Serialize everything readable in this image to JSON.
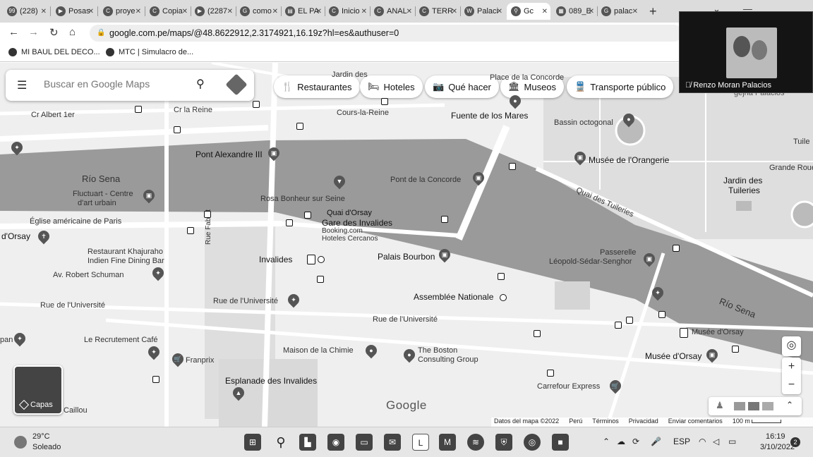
{
  "browser": {
    "tabs": [
      {
        "icon": "notification-badge-icon",
        "title": "(228)"
      },
      {
        "icon": "video-icon",
        "title": "Posas"
      },
      {
        "icon": "c-logo-icon",
        "title": "proye"
      },
      {
        "icon": "c-logo-icon",
        "title": "Copia"
      },
      {
        "icon": "youtube-icon",
        "title": "(2287"
      },
      {
        "icon": "google-icon",
        "title": "como"
      },
      {
        "icon": "newspaper-icon",
        "title": "EL PA"
      },
      {
        "icon": "c-logo-icon",
        "title": "Inicio"
      },
      {
        "icon": "c-logo-icon",
        "title": "ANAL"
      },
      {
        "icon": "c-logo-icon",
        "title": "TERR"
      },
      {
        "icon": "wikipedia-icon",
        "title": "Palaci"
      },
      {
        "icon": "maps-pin-icon",
        "title": "Gc"
      },
      {
        "icon": "grid-icon",
        "title": "089_E"
      },
      {
        "icon": "google-icon",
        "title": "palac"
      }
    ],
    "active_tab_index": 11,
    "url": "google.com.pe/maps/@48.8622912,2.3174921,16.19z?hl=es&authuser=0",
    "bookmarks": [
      "MI BAUL DEL DECO...",
      "MTC | Simulacro de..."
    ],
    "new_tab_label": "+"
  },
  "video_call": {
    "participant": "Renzo Moran Palacios"
  },
  "maps": {
    "search_placeholder": "Buscar en Google Maps",
    "chips": [
      {
        "icon": "fork-knife-icon",
        "label": "Restaurantes"
      },
      {
        "icon": "bed-icon",
        "label": "Hoteles"
      },
      {
        "icon": "camera-icon",
        "label": "Qué hacer"
      },
      {
        "icon": "museum-icon",
        "label": "Museos"
      },
      {
        "icon": "train-icon",
        "label": "Transporte público"
      }
    ],
    "layers_label": "Capas",
    "zoom_in": "+",
    "zoom_out": "−",
    "logo": "Google",
    "attribution": {
      "data": "Datos del mapa ©2022",
      "country": "Perú",
      "terms": "Términos",
      "privacy": "Privacidad",
      "feedback": "Enviar comentarios",
      "scale": "100 m"
    },
    "labels": {
      "jardin_top": "Jardin des",
      "place_top": "Place de la Concorde",
      "cr_albert": "Cr Albert 1er",
      "cr_la_reine": "Cr la Reine",
      "cours_la_reine": "Cours-la-Reine",
      "fuente": "Fuente de los Mares",
      "bassin": "Bassin octogonal",
      "tuile": "Tuile",
      "pont_alexandre": "Pont Alexandre III",
      "musee_orangerie": "Musée de l'Orangerie",
      "grande_roue": "Grande Roue",
      "rio_sena_1": "Río Sena",
      "fluctuart": "Fluctuart - Centre",
      "fluctuart_2": "d'art urbain",
      "rosa_bonheur": "Rosa Bonheur sur Seine",
      "pont_concorde": "Pont de la Concorde",
      "quai_tuileries": "Quai des Tuileries",
      "jardin_tuileries": "Jardin des",
      "jardin_tuileries_2": "Tuileries",
      "eglise": "Église américaine de Paris",
      "quai_orsay": "Quai d'Orsay",
      "gare_invalides": "Gare des Invalides",
      "booking": "Booking.com",
      "booking_2": "Hoteles Cercanos",
      "dorsay": "d'Orsay",
      "rue_fabert": "Rue Fabert",
      "restaurant_kh": "Restaurant Khajuraho",
      "restaurant_kh_2": "Indien Fine Dining Bar",
      "invalides": "Invalides",
      "palais_bourbon": "Palais Bourbon",
      "passerelle": "Passerelle",
      "leopold": "Léopold-Sédar-Senghor",
      "av_schuman": "Av. Robert Schuman",
      "assemblee": "Assemblée Nationale",
      "rue_univ_1": "Rue de l'Université",
      "rue_univ_2": "Rue de l'Université",
      "rue_univ_3": "Rue de l'Université",
      "rio_sena_2": "Río Sena",
      "musee_orsay_1": "Musée d'Orsay",
      "musee_orsay_2": "Musée d'Orsay",
      "recrutement": "Le Recrutement Café",
      "maison_chimie": "Maison de la Chimie",
      "boston": "The Boston",
      "boston_2": "Consulting Group",
      "franprix": "Franprix",
      "esplanade": "Esplanade des Invalides",
      "carrefour": "Carrefour Express",
      "caillou": "Caillou",
      "pan": "pan",
      "gejna": "gejna Palacios"
    }
  },
  "taskbar": {
    "weather_temp": "29°C",
    "weather_cond": "Soleado",
    "lang": "ESP",
    "time": "16:19",
    "date": "3/10/2022",
    "notifications": "2",
    "apps": [
      "windows-start-icon",
      "search-icon",
      "snip-icon",
      "teams-icon",
      "files-icon",
      "mail-icon",
      "l-app-icon",
      "m-app-icon",
      "spotify-icon",
      "shield-icon",
      "chrome-icon",
      "video-icon"
    ]
  }
}
